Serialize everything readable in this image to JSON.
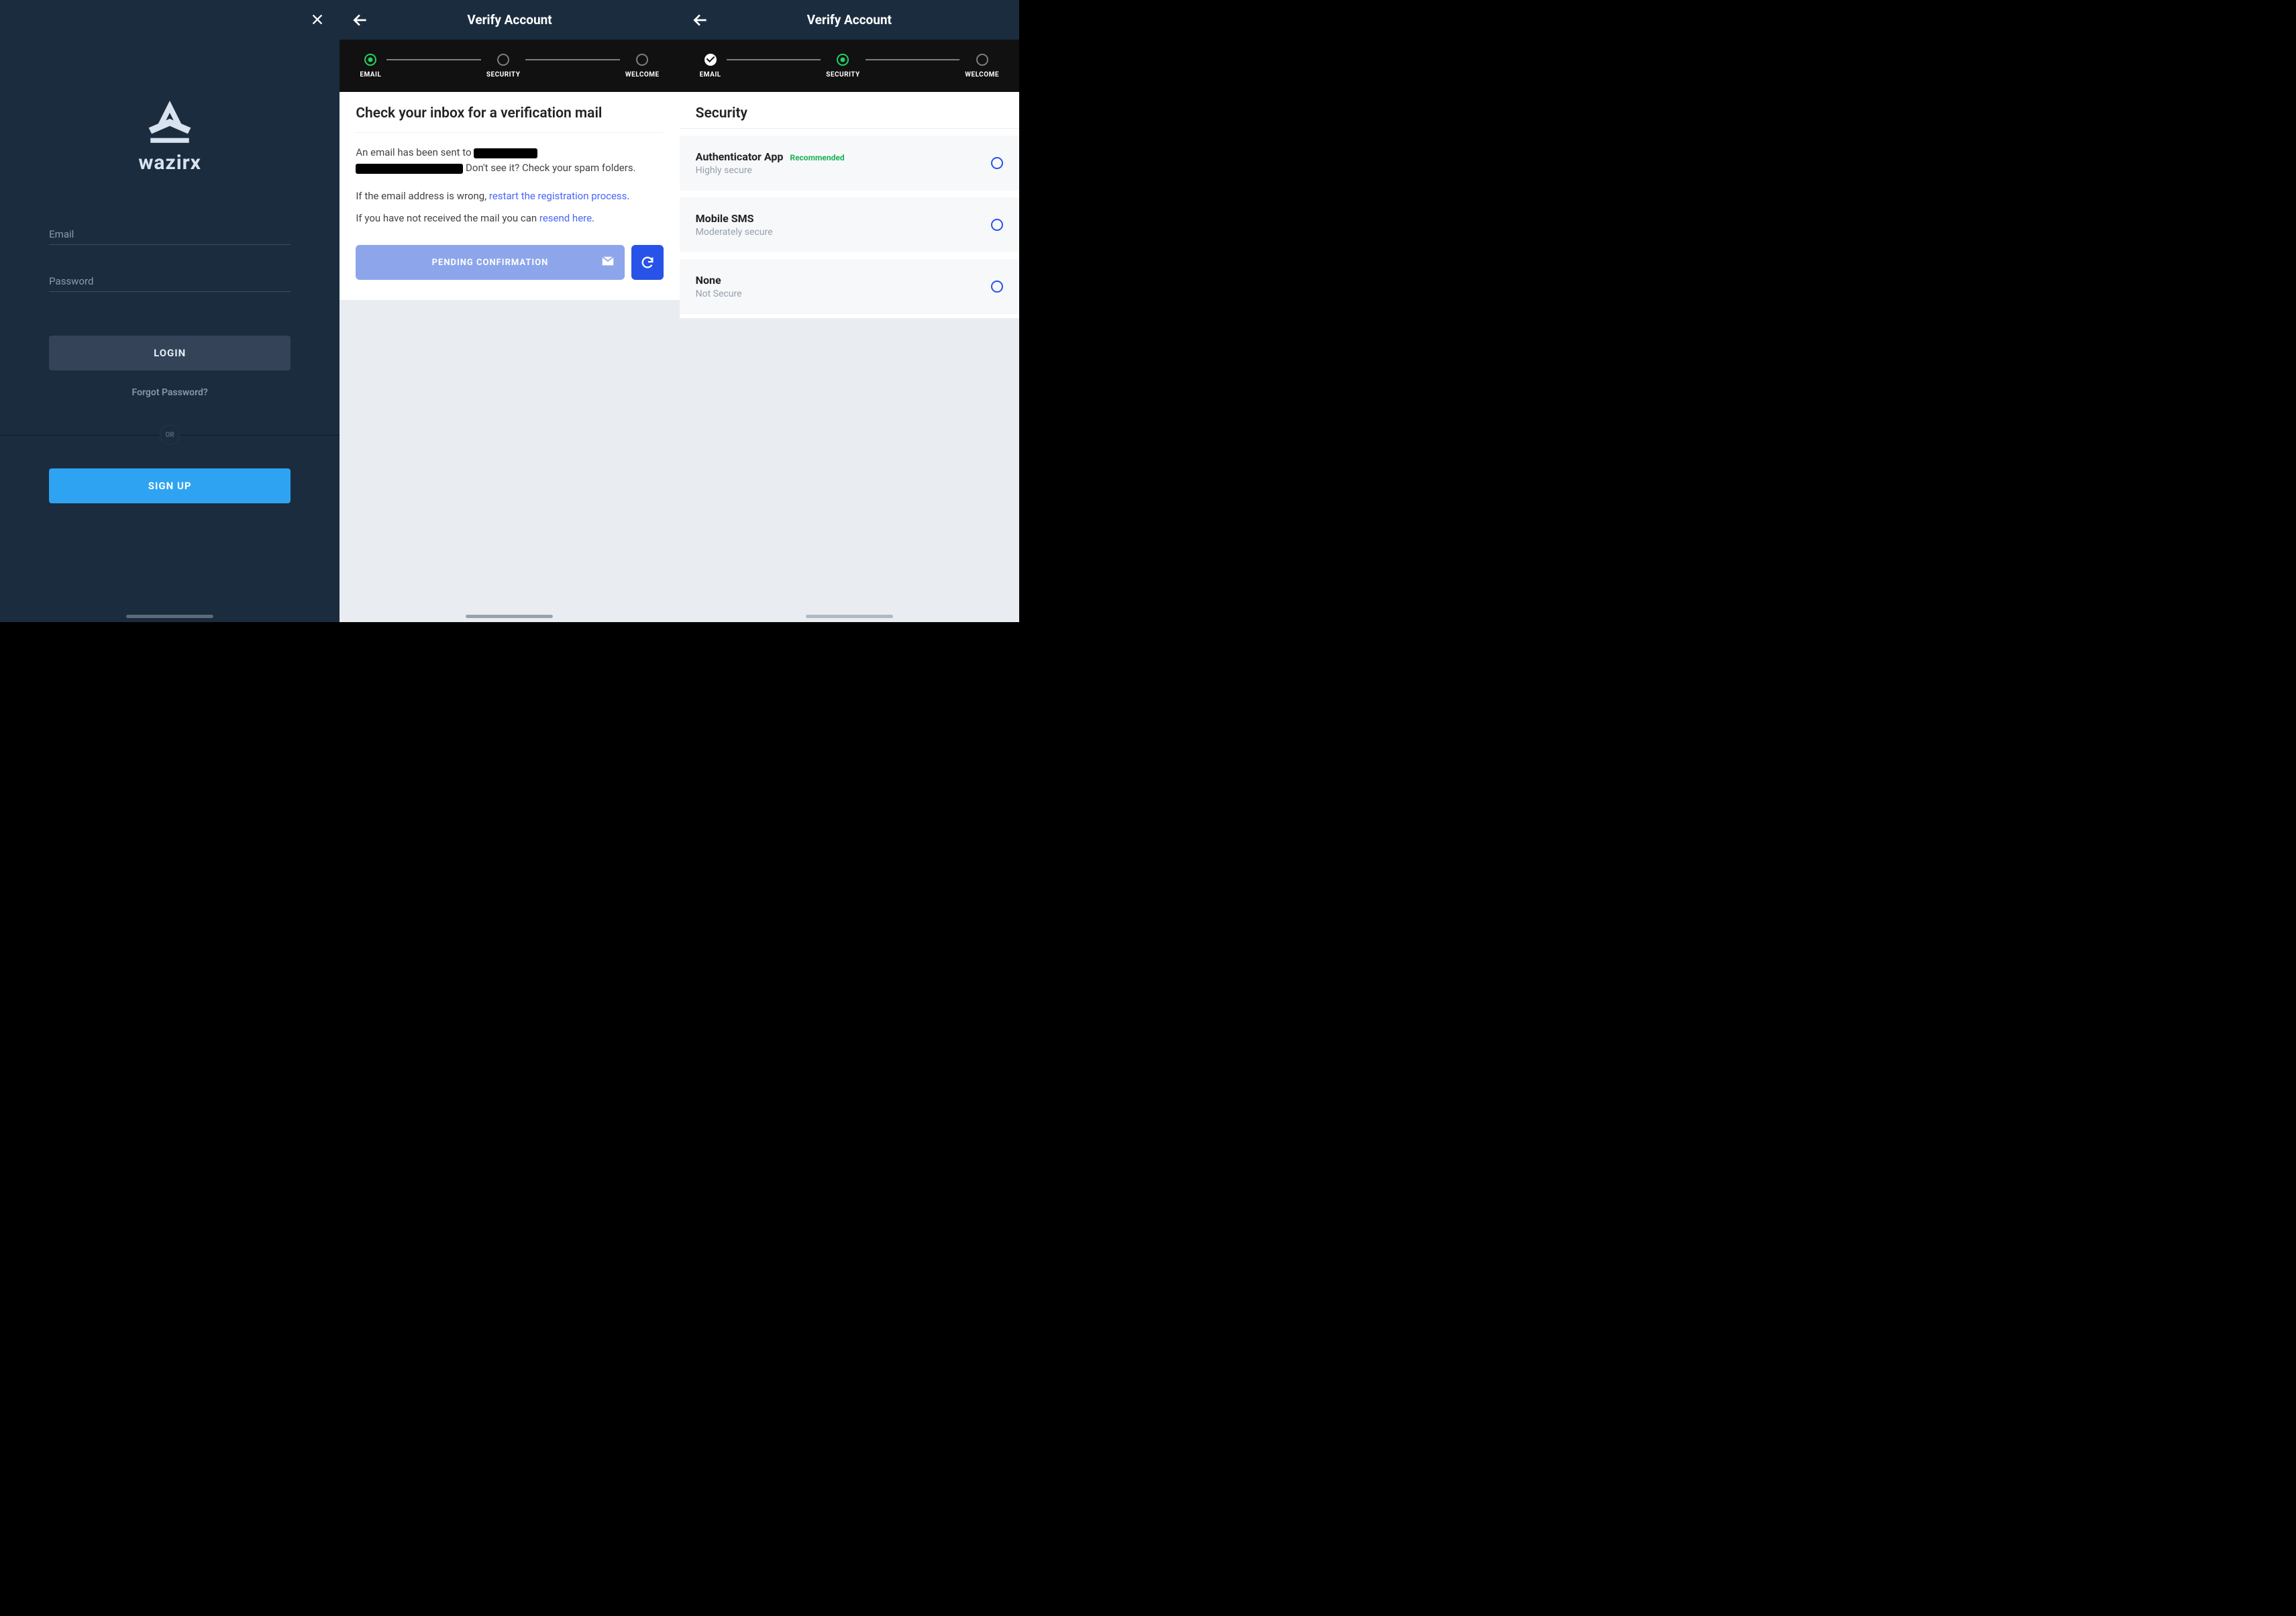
{
  "login": {
    "brand": "wazirx",
    "email_placeholder": "Email",
    "password_placeholder": "Password",
    "login_btn": "LOGIN",
    "forgot": "Forgot Password?",
    "or": "OR",
    "signup_btn": "SIGN UP"
  },
  "verify1": {
    "title": "Verify Account",
    "steps": {
      "s1": "EMAIL",
      "s2": "SECURITY",
      "s3": "WELCOME"
    },
    "card_title": "Check your inbox for a verification mail",
    "line1a": "An email has been sent to ",
    "line1b": " Don't see it? Check your spam folders.",
    "line2a": "If the email address is wrong, ",
    "line2link": "restart the registration process",
    "line3a": "If you have not received the mail you can ",
    "line3link": "resend here",
    "pending": "PENDING CONFIRMATION"
  },
  "verify2": {
    "title": "Verify Account",
    "steps": {
      "s1": "EMAIL",
      "s2": "SECURITY",
      "s3": "WELCOME"
    },
    "heading": "Security",
    "opts": [
      {
        "title": "Authenticator App",
        "rec": "Recommended",
        "sub": "Highly secure"
      },
      {
        "title": "Mobile SMS",
        "rec": "",
        "sub": "Moderately secure"
      },
      {
        "title": "None",
        "rec": "",
        "sub": "Not Secure"
      }
    ]
  }
}
